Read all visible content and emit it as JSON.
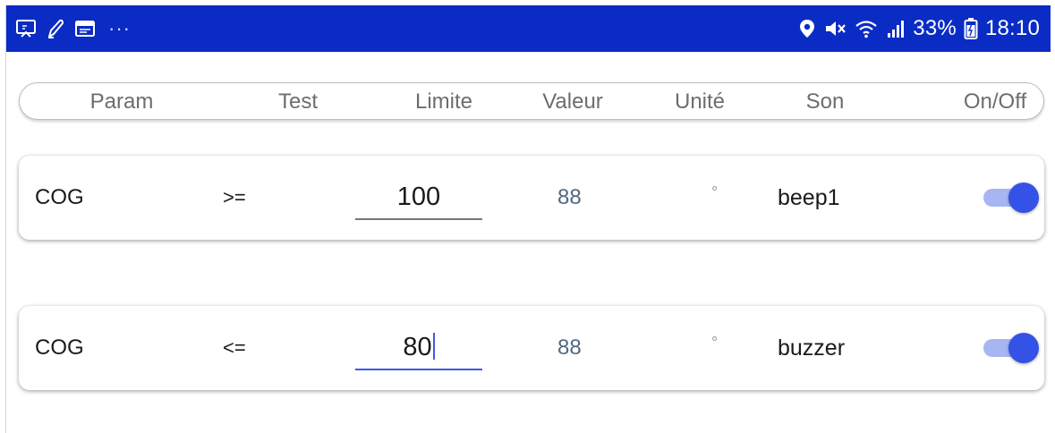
{
  "status_bar": {
    "left_icons": [
      "screen-mirror-icon",
      "pen-icon",
      "window-icon"
    ],
    "more": "···",
    "right_icons": [
      "location-pin-icon",
      "mute-icon",
      "wifi-icon",
      "signal-icon",
      "battery-icon"
    ],
    "battery": "33%",
    "time": "18:10",
    "color": "#0a2cc4"
  },
  "header": {
    "columns": [
      "Param",
      "Test",
      "Limite",
      "Valeur",
      "Unité",
      "Son",
      "On/Off"
    ]
  },
  "rows": [
    {
      "param": "COG",
      "test": ">=",
      "limite": "100",
      "valeur": "88",
      "unite": "°",
      "son": "beep1",
      "enabled": true,
      "focused": false
    },
    {
      "param": "COG",
      "test": "<=",
      "limite": "80",
      "valeur": "88",
      "unite": "°",
      "son": "buzzer",
      "enabled": true,
      "focused": true
    }
  ],
  "colors": {
    "accent": "#3552e6",
    "track": "#a7b6f2",
    "valeur_text": "#4d6a82"
  }
}
